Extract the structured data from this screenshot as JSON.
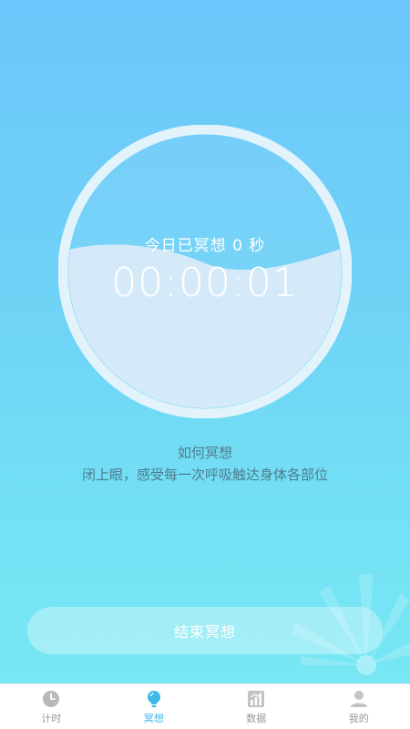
{
  "meditation": {
    "today_label": "今日已冥想 0 秒",
    "timer": "00:00:01"
  },
  "guide": {
    "title": "如何冥想",
    "text": "闭上眼，感受每一次呼吸触达身体各部位"
  },
  "actions": {
    "end_label": "结束冥想"
  },
  "tabbar": {
    "items": [
      {
        "label": "计时",
        "icon": "clock-icon",
        "active": false
      },
      {
        "label": "冥想",
        "icon": "lightbulb-icon",
        "active": true
      },
      {
        "label": "数据",
        "icon": "bar-chart-icon",
        "active": false
      },
      {
        "label": "我的",
        "icon": "user-icon",
        "active": false
      }
    ]
  },
  "colors": {
    "accent": "#3fb8e8",
    "inactive_tab": "#9a9a9a",
    "guide_text": "#4e7d8c",
    "bg_top": "#6cc6fb",
    "bg_bottom": "#79e9f3"
  }
}
